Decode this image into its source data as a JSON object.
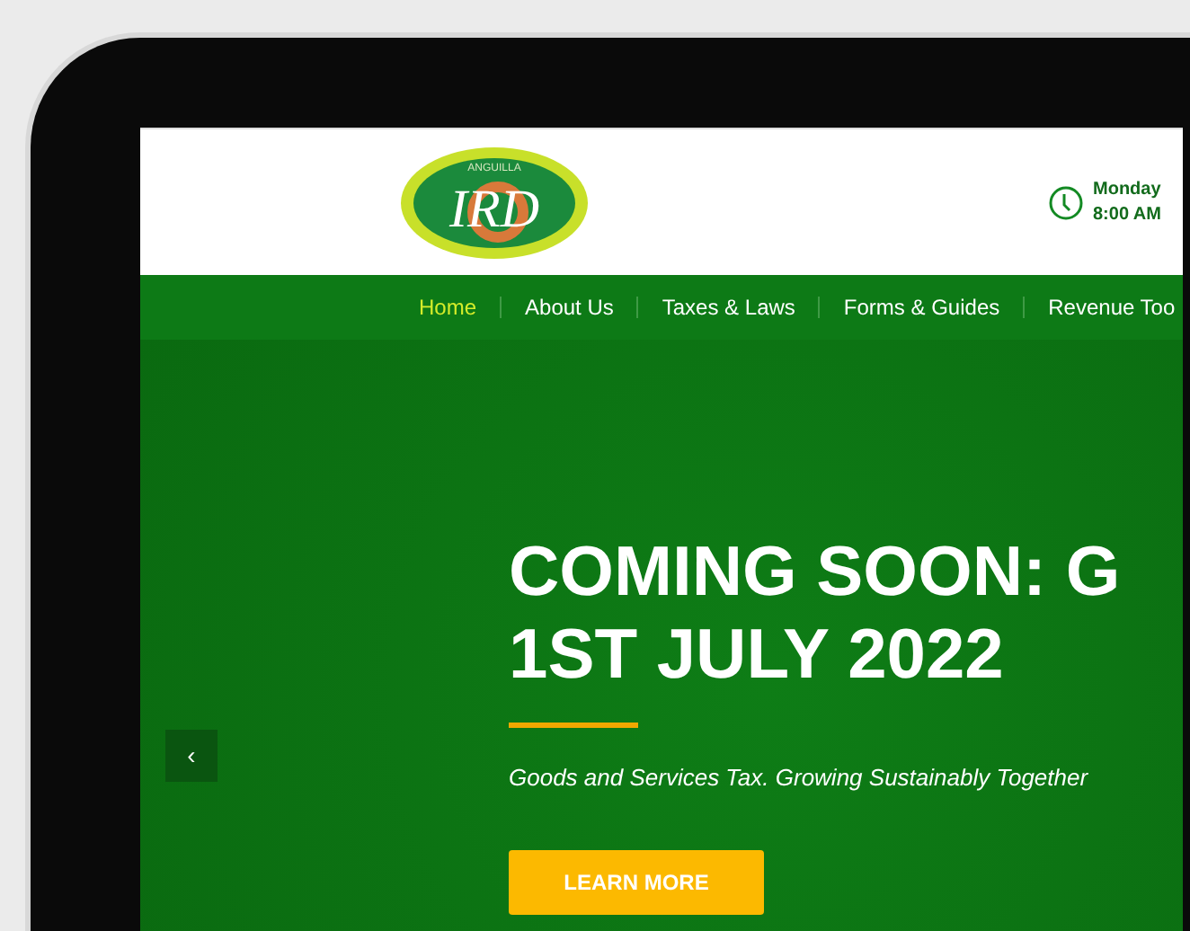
{
  "logo": {
    "top_text": "ANGUILLA",
    "initials": "IRD"
  },
  "hours": {
    "day": "Monday",
    "time": "8:00 AM"
  },
  "nav": [
    {
      "label": "Home",
      "selected": true
    },
    {
      "label": "About Us",
      "selected": false
    },
    {
      "label": "Taxes & Laws",
      "selected": false
    },
    {
      "label": "Forms & Guides",
      "selected": false
    },
    {
      "label": "Revenue Too",
      "selected": false
    }
  ],
  "hero": {
    "title_lines": [
      "COMING SOON: G",
      "1ST JULY 2022"
    ],
    "subtitle": "Goods and Services Tax. Growing Sustainably Together",
    "button": "LEARN MORE",
    "prev_arrow": "‹"
  }
}
